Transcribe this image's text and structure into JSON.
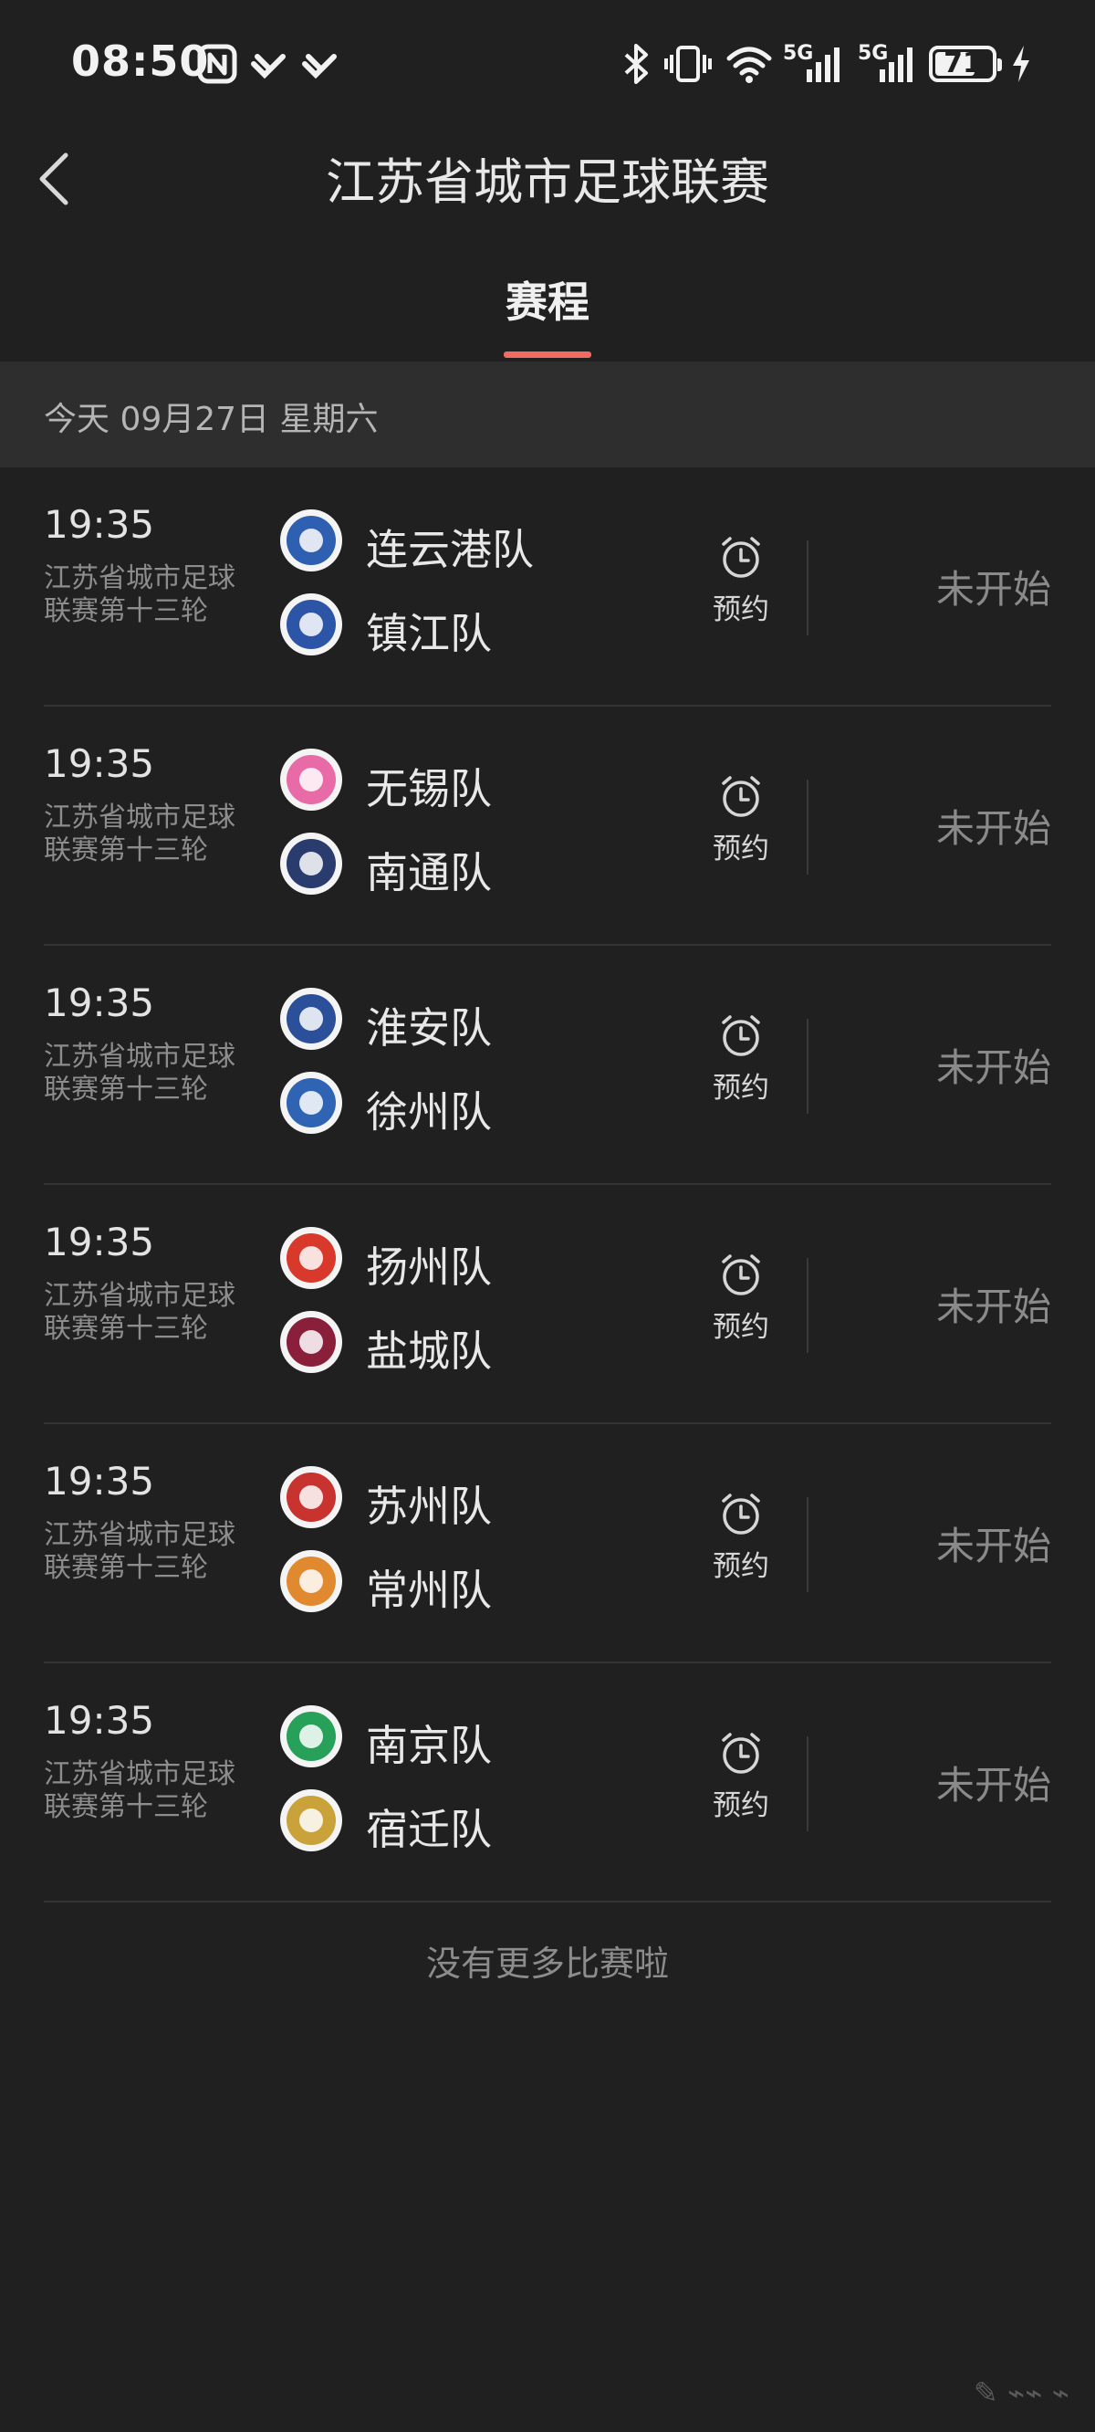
{
  "status_bar": {
    "time": "08:50",
    "network_1": "5G",
    "network_2": "5G",
    "battery": "71",
    "battery_level": 0.71
  },
  "header": {
    "title": "江苏省城市足球联赛",
    "back_icon": "chevron-left-icon"
  },
  "tabs": [
    {
      "label": "赛程",
      "active": true
    }
  ],
  "date_bar": {
    "text": "今天 09月27日 星期六"
  },
  "matches": [
    {
      "time": "19:35",
      "round": "江苏省城市足球联赛第十三轮",
      "home": {
        "name": "连云港队",
        "color": "#2f5fb0"
      },
      "away": {
        "name": "镇江队",
        "color": "#2c55a8"
      },
      "reserve_label": "预约",
      "status": "未开始"
    },
    {
      "time": "19:35",
      "round": "江苏省城市足球联赛第十三轮",
      "home": {
        "name": "无锡队",
        "color": "#e86aa6"
      },
      "away": {
        "name": "南通队",
        "color": "#2a3b6e"
      },
      "reserve_label": "预约",
      "status": "未开始"
    },
    {
      "time": "19:35",
      "round": "江苏省城市足球联赛第十三轮",
      "home": {
        "name": "淮安队",
        "color": "#2c4f9a"
      },
      "away": {
        "name": "徐州队",
        "color": "#2f63b4"
      },
      "reserve_label": "预约",
      "status": "未开始"
    },
    {
      "time": "19:35",
      "round": "江苏省城市足球联赛第十三轮",
      "home": {
        "name": "扬州队",
        "color": "#d8392b"
      },
      "away": {
        "name": "盐城队",
        "color": "#8a1f3c"
      },
      "reserve_label": "预约",
      "status": "未开始"
    },
    {
      "time": "19:35",
      "round": "江苏省城市足球联赛第十三轮",
      "home": {
        "name": "苏州队",
        "color": "#c8322f"
      },
      "away": {
        "name": "常州队",
        "color": "#e0892e"
      },
      "reserve_label": "预约",
      "status": "未开始"
    },
    {
      "time": "19:35",
      "round": "江苏省城市足球联赛第十三轮",
      "home": {
        "name": "南京队",
        "color": "#27a05a"
      },
      "away": {
        "name": "宿迁队",
        "color": "#c9a23a"
      },
      "reserve_label": "预约",
      "status": "未开始"
    }
  ],
  "footer": {
    "no_more": "没有更多比赛啦"
  },
  "colors": {
    "accent": "#f26b63",
    "background": "#202020",
    "date_bar": "#2e2e2f"
  }
}
